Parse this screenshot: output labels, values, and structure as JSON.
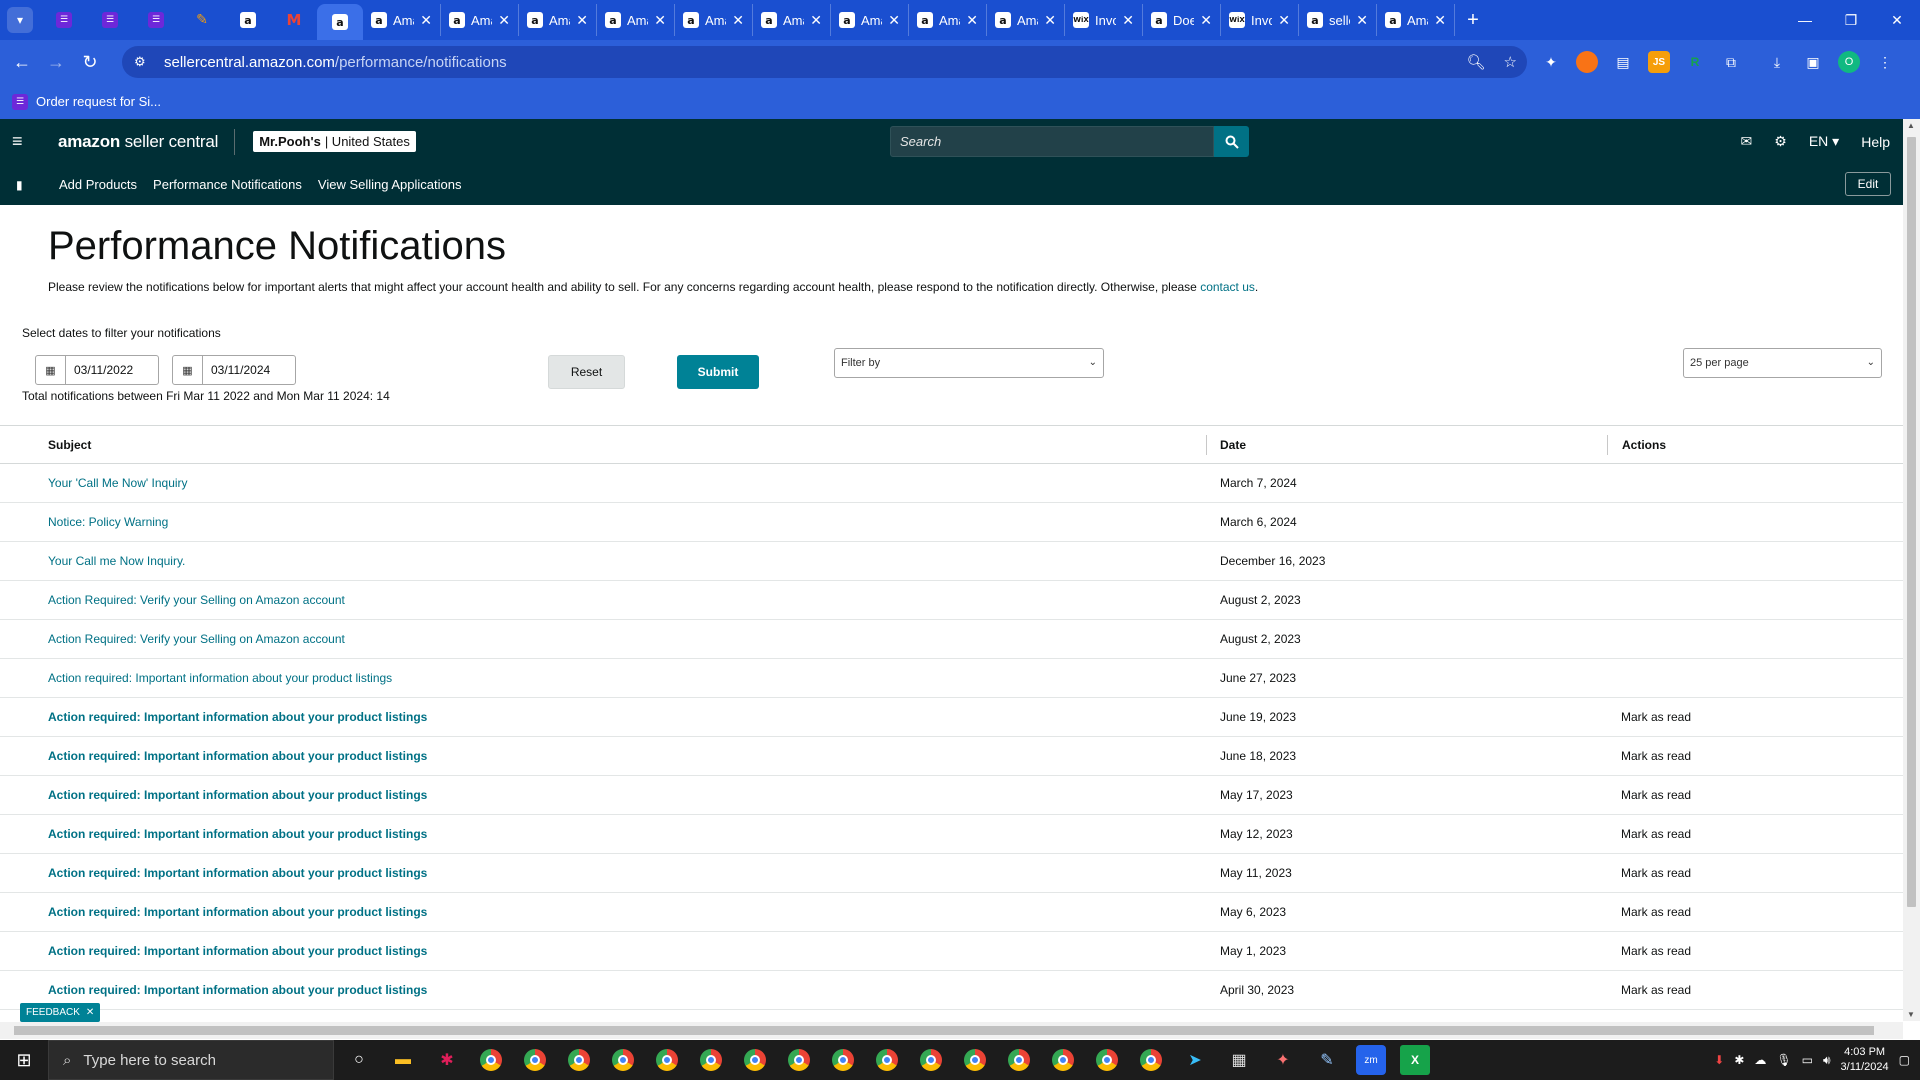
{
  "browser": {
    "pinned_tabs": [
      "list-icon",
      "list-icon",
      "list-icon",
      "slack-icon",
      "amazon-icon",
      "gmail-icon",
      "amazon-icon"
    ],
    "tabs": [
      {
        "title": "Ama",
        "icon": "amazon-icon"
      },
      {
        "title": "Ama",
        "icon": "amazon-icon"
      },
      {
        "title": "Ama",
        "icon": "amazon-icon"
      },
      {
        "title": "Ama",
        "icon": "amazon-icon"
      },
      {
        "title": "Ama",
        "icon": "amazon-icon"
      },
      {
        "title": "Ama",
        "icon": "amazon-icon"
      },
      {
        "title": "Ama",
        "icon": "amazon-icon"
      },
      {
        "title": "Ama",
        "icon": "amazon-icon"
      },
      {
        "title": "Ama",
        "icon": "amazon-icon"
      },
      {
        "title": "Invo",
        "icon": "wix-icon"
      },
      {
        "title": "Doe",
        "icon": "amazon-icon"
      },
      {
        "title": "Invo",
        "icon": "wix-icon"
      },
      {
        "title": "selle",
        "icon": "amazon-icon"
      },
      {
        "title": "Ama",
        "icon": "amazon-icon"
      }
    ],
    "url_host": "sellercentral.amazon.com",
    "url_path": "/performance/notifications",
    "profile_initial": "O",
    "bookmark": "Order request for Si..."
  },
  "header": {
    "logo_bold": "amazon",
    "logo_rest": "seller central",
    "account_name": "Mr.Pooh's",
    "account_region": "| United States",
    "search_placeholder": "Search",
    "language": "EN",
    "help": "Help"
  },
  "subnav": {
    "links": [
      "Add Products",
      "Performance Notifications",
      "View Selling Applications"
    ],
    "edit": "Edit"
  },
  "page": {
    "title": "Performance Notifications",
    "description": "Please review the notifications below for important alerts that might affect your account health and ability to sell. For any concerns regarding account health, please respond to the notification directly. Otherwise, please ",
    "contact_link": "contact us",
    "description_end": ".",
    "filter_label": "Select dates to filter your notifications",
    "date_from": "03/11/2022",
    "date_to": "03/11/2024",
    "reset": "Reset",
    "submit": "Submit",
    "filter_by": "Filter by",
    "per_page": "25 per page",
    "total": "Total notifications between Fri Mar 11 2022 and Mon Mar 11 2024: 14"
  },
  "table": {
    "headers": {
      "subject": "Subject",
      "date": "Date",
      "actions": "Actions"
    },
    "rows": [
      {
        "subject": "Your 'Call Me Now' Inquiry",
        "date": "March 7, 2024",
        "action": "",
        "unread": false
      },
      {
        "subject": "Notice: Policy Warning",
        "date": "March 6, 2024",
        "action": "",
        "unread": false
      },
      {
        "subject": "Your Call me Now Inquiry.",
        "date": "December 16, 2023",
        "action": "",
        "unread": false
      },
      {
        "subject": "Action Required: Verify your Selling on Amazon account",
        "date": "August 2, 2023",
        "action": "",
        "unread": false
      },
      {
        "subject": "Action Required: Verify your Selling on Amazon account",
        "date": "August 2, 2023",
        "action": "",
        "unread": false
      },
      {
        "subject": "Action required: Important information about your product listings",
        "date": "June 27, 2023",
        "action": "",
        "unread": false
      },
      {
        "subject": "Action required: Important information about your product listings",
        "date": "June 19, 2023",
        "action": "Mark as read",
        "unread": true
      },
      {
        "subject": "Action required: Important information about your product listings",
        "date": "June 18, 2023",
        "action": "Mark as read",
        "unread": true
      },
      {
        "subject": "Action required: Important information about your product listings",
        "date": "May 17, 2023",
        "action": "Mark as read",
        "unread": true
      },
      {
        "subject": "Action required: Important information about your product listings",
        "date": "May 12, 2023",
        "action": "Mark as read",
        "unread": true
      },
      {
        "subject": "Action required: Important information about your product listings",
        "date": "May 11, 2023",
        "action": "Mark as read",
        "unread": true
      },
      {
        "subject": "Action required: Important information about your product listings",
        "date": "May 6, 2023",
        "action": "Mark as read",
        "unread": true
      },
      {
        "subject": "Action required: Important information about your product listings",
        "date": "May 1, 2023",
        "action": "Mark as read",
        "unread": true
      },
      {
        "subject": "Action required: Important information about your product listings",
        "date": "April 30, 2023",
        "action": "Mark as read",
        "unread": true
      }
    ]
  },
  "feedback": "FEEDBACK",
  "taskbar": {
    "search_placeholder": "Type here to search",
    "time": "4:03 PM",
    "date": "3/11/2024"
  },
  "colors": {
    "header_bg": "#002f36",
    "link": "#007185",
    "submit": "#008296",
    "browser_tabstrip": "#1a4fd0"
  }
}
